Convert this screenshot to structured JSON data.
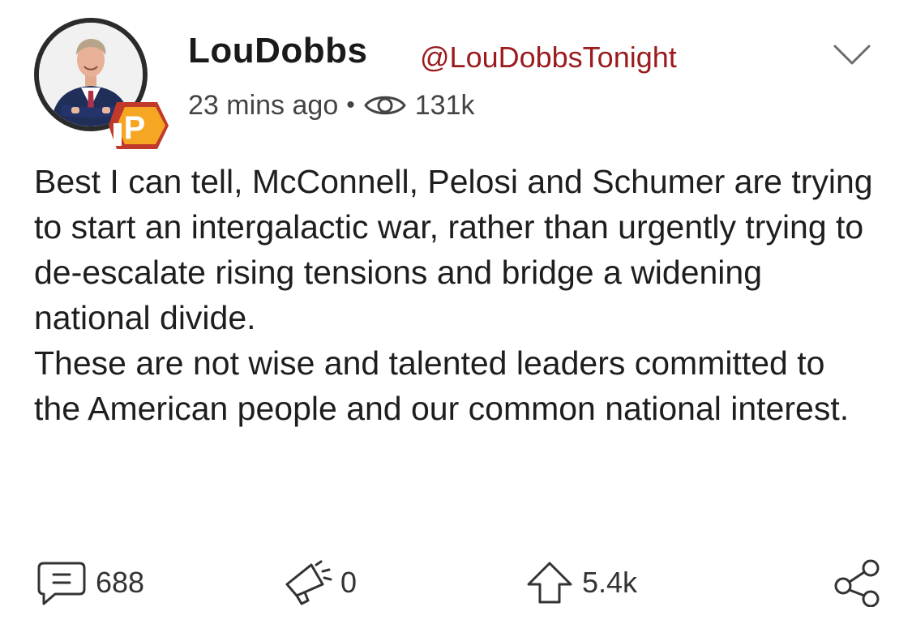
{
  "post": {
    "author": {
      "display_name": "LouDobbs",
      "handle": "@LouDobbsTonight",
      "avatar_icon": "profile-photo",
      "badge_icon": "parler-verified-badge"
    },
    "meta": {
      "time_ago": "23 mins ago",
      "separator": "•",
      "views_icon": "eye-icon",
      "views": "131k"
    },
    "menu_icon": "chevron-down-icon",
    "body": [
      "Best I can tell, McConnell, Pelosi and Schumer are trying to start an intergalactic war, rather than urgently trying to de-escalate rising tensions and bridge a widening national divide.",
      "These are not wise and talented leaders committed to the American people and our common national interest."
    ],
    "actions": {
      "comments": {
        "icon": "comment-icon",
        "count": "688"
      },
      "echoes": {
        "icon": "megaphone-icon",
        "count": "0"
      },
      "upvotes": {
        "icon": "upvote-arrow-icon",
        "count": "5.4k"
      },
      "share": {
        "icon": "share-icon"
      }
    }
  },
  "colors": {
    "handle": "#9b1b1e",
    "text": "#1e1e1e",
    "badge_orange": "#f5a623",
    "badge_red": "#c0392b"
  }
}
